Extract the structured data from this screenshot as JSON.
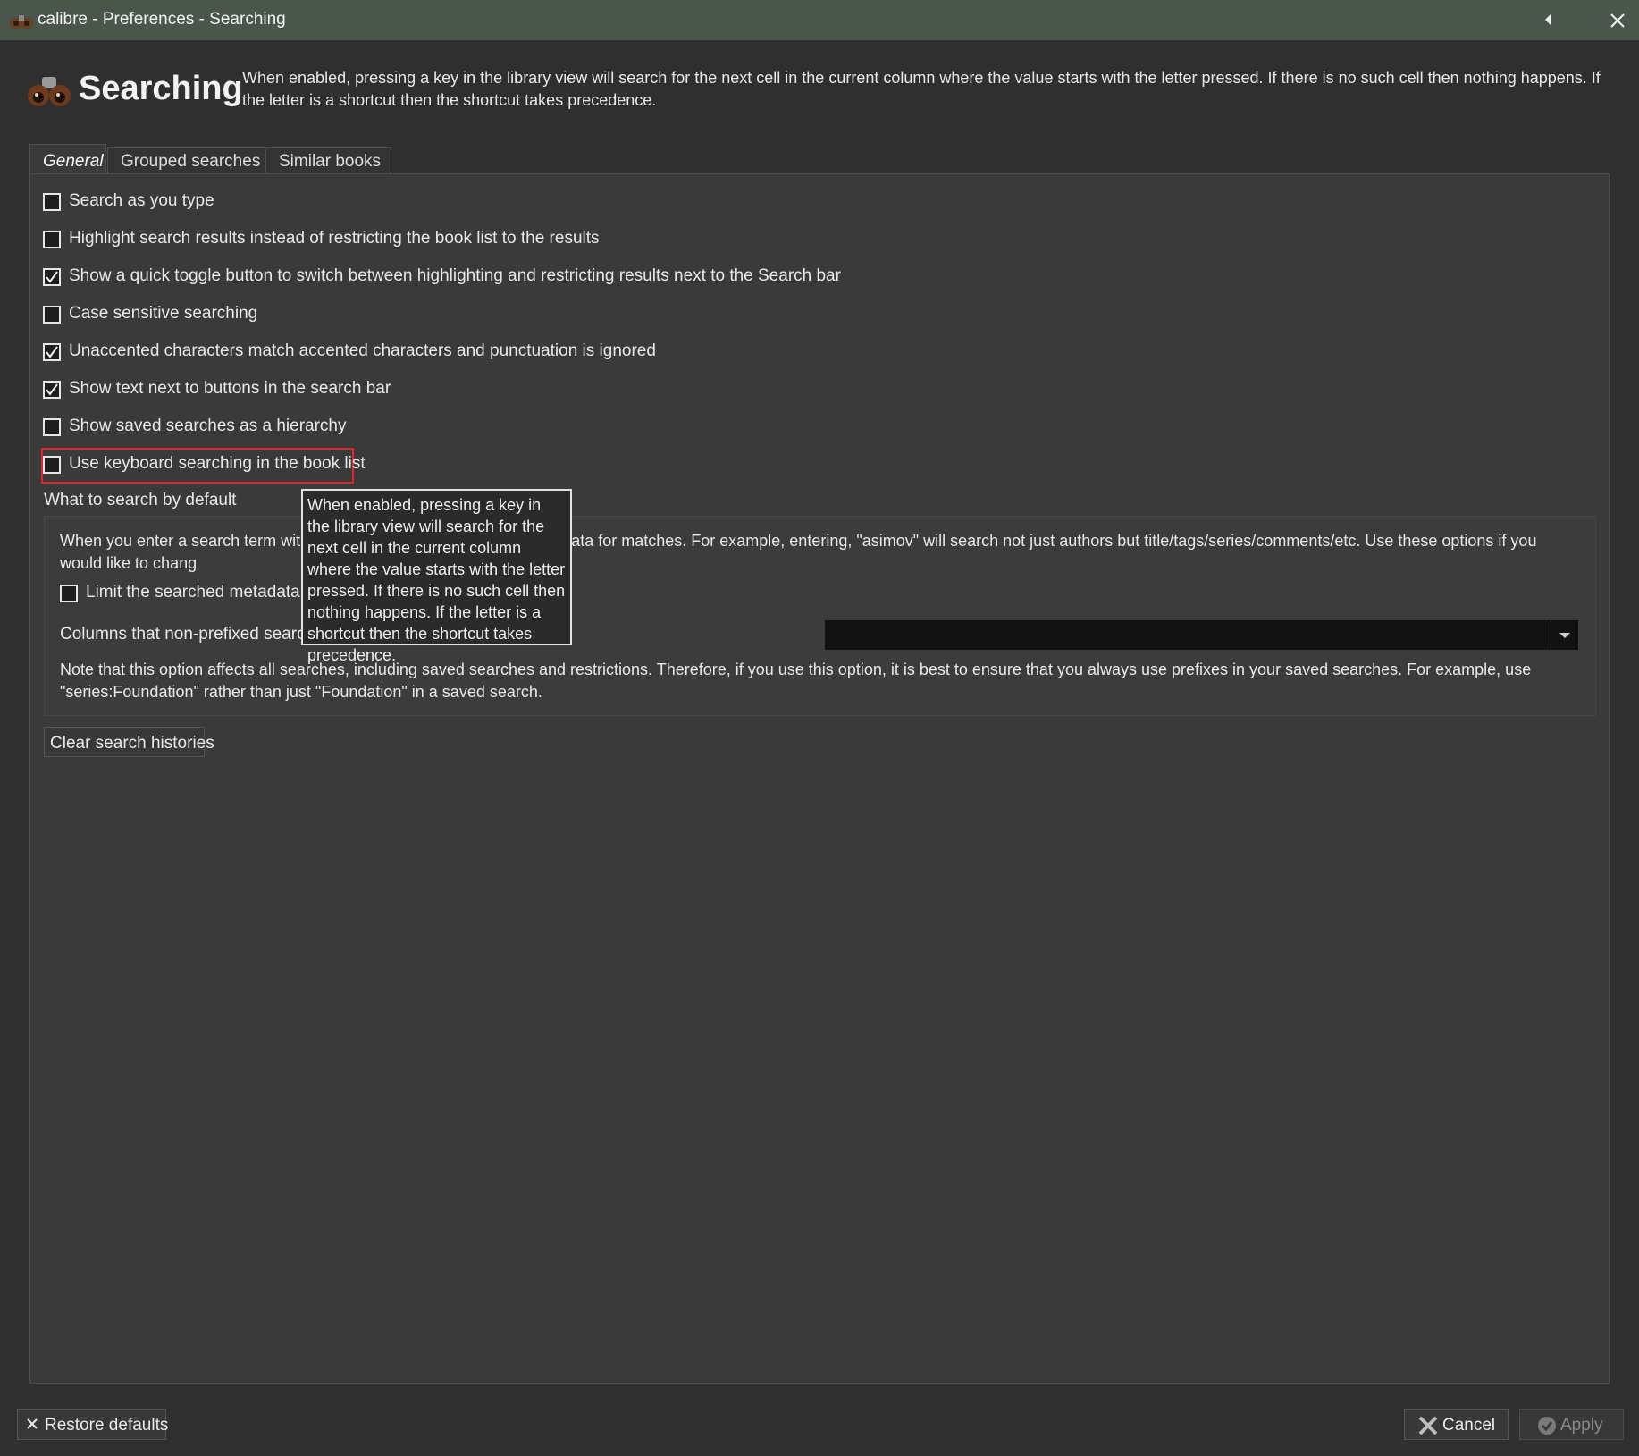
{
  "window": {
    "title": "calibre - Preferences - Searching"
  },
  "header": {
    "title": "Searching",
    "description": "When enabled, pressing a key in the library view will search for the next cell in the current column where the value starts with the letter pressed. If there is no such cell then nothing happens. If the letter is a shortcut then the shortcut takes precedence."
  },
  "tabs": [
    {
      "label": "General",
      "active": true
    },
    {
      "label": "Grouped searches",
      "active": false
    },
    {
      "label": "Similar books",
      "active": false
    }
  ],
  "options": [
    {
      "label": "Search as you type",
      "checked": false
    },
    {
      "label": "Highlight search results instead of restricting the book list to the results",
      "checked": false
    },
    {
      "label": "Show a quick toggle button to switch between highlighting and restricting results next to the Search bar",
      "checked": true
    },
    {
      "label": "Case sensitive searching",
      "checked": false
    },
    {
      "label": "Unaccented characters match accented characters and punctuation is ignored",
      "checked": true
    },
    {
      "label": "Show text next to buttons in the search bar",
      "checked": true
    },
    {
      "label": "Show saved searches as a hierarchy",
      "checked": false
    },
    {
      "label": "Use keyboard searching in the book list",
      "checked": false
    }
  ],
  "default_search": {
    "title": "What to search by default",
    "description": "When you enter a search term wit                                        rch all metadata for matches. For example, entering, \"asimov\" will search not just authors but title/tags/series/comments/etc. Use these options if you would like to chang",
    "limit_label": "Limit the searched metadata",
    "limit_checked": false,
    "columns_label": "Columns that non-prefixed search",
    "columns_value": "",
    "note": "Note that this option affects all searches, including saved searches and restrictions. Therefore, if you use this option, it is best to ensure that you always use prefixes in your saved searches. For example, use \"series:Foundation\" rather than just \"Foundation\" in a saved search."
  },
  "clear_button": "Clear search histories",
  "tooltip": "When enabled, pressing a key in the library view will search for the next cell in the current column where the value starts with the letter pressed. If there is no such cell then nothing happens. If the letter is a shortcut then the shortcut takes precedence.",
  "footer": {
    "restore": "Restore defaults",
    "cancel": "Cancel",
    "apply": "Apply"
  },
  "colors": {
    "highlight_border": "#e5232d",
    "titlebar": "#4a554b"
  }
}
